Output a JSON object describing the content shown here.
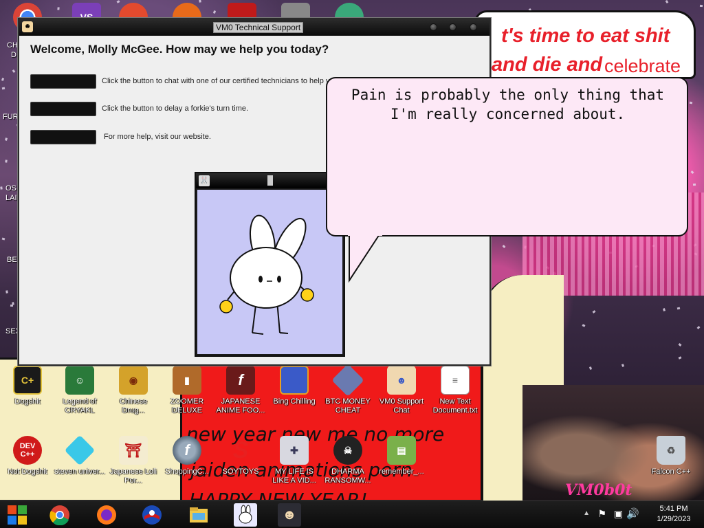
{
  "desktop": {
    "top_bubble": {
      "line1": "t's time to eat shit",
      "line2": "and die and",
      "line2b": "celebrate"
    },
    "sign": {
      "line1": "new year new me no more",
      "line2": "jaiden animations porn",
      "line3": "HAPPY NEW YEAR!"
    },
    "logo": "VM0b0t",
    "edge_labels": [
      "CH",
      "D",
      "FUR",
      "OS",
      "LAI",
      "BE",
      "SEX"
    ],
    "icons": [
      {
        "label": "Dogshit",
        "icon": "crt-icon"
      },
      {
        "label": "Legend of CRYAKL",
        "icon": "pixel-character-icon"
      },
      {
        "label": "Chinese Drug...",
        "icon": "coin-box-icon"
      },
      {
        "label": "ZOOMER DELUXE",
        "icon": "moai-icon"
      },
      {
        "label": "JAPANESE ANIME FOO...",
        "icon": "flash-icon"
      },
      {
        "label": "Bing Chilling",
        "icon": "book-icon"
      },
      {
        "label": "BTC MONEY CHEAT",
        "icon": "cube-icon"
      },
      {
        "label": "VM0 Support Chat",
        "icon": "support-agent-icon"
      },
      {
        "label": "New Text Document.txt",
        "icon": "text-file-icon"
      },
      {
        "label": "Not Dogshit",
        "icon": "devcpp-icon"
      },
      {
        "label": "steven univer...",
        "icon": "diamond-icon"
      },
      {
        "label": "Japanese Loli Por...",
        "icon": "torii-icon"
      },
      {
        "label": "ShoppingC...",
        "icon": "flash-player-icon"
      },
      {
        "label": "SOYTOYS",
        "icon": "soytoys-icon"
      },
      {
        "label": "MY LIFE IS LIKE A VID...",
        "icon": "gamepad-icon"
      },
      {
        "label": "DHARMA RANSOMW...",
        "icon": "skull-icon"
      },
      {
        "label": "remember_...",
        "icon": "archive-icon"
      },
      {
        "label": "Falcon C++",
        "icon": "recycle-bin-icon"
      }
    ],
    "devcpp_text": "DEV C++"
  },
  "support_window": {
    "title": "VM0 Technical Support",
    "heading": "Welcome, Molly McGee. How may we help you today?",
    "options": [
      {
        "text": "Click the button to chat with one of our certified technicians to help yo"
      },
      {
        "text": "Click the button to delay a forkie's turn time."
      },
      {
        "text": "For more help, visit our website."
      }
    ]
  },
  "bunny_window": {
    "title": ""
  },
  "speech_bubble": {
    "text": "Pain is probably the only thing that I'm really concerned about."
  },
  "taskbar": {
    "items": [
      "start-icon",
      "chrome-icon",
      "firefox-icon",
      "obama-icon",
      "file-explorer-icon",
      "bunny-app-icon",
      "support-agent-icon"
    ],
    "clock": {
      "time": "5:41 PM",
      "date": "1/29/2023"
    }
  }
}
